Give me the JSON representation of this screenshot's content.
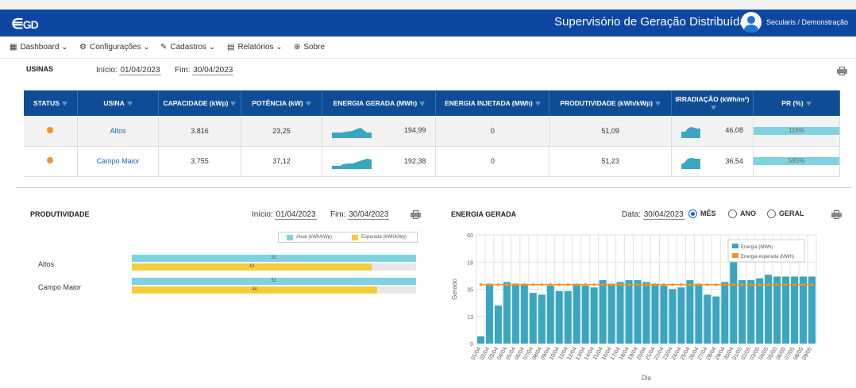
{
  "header": {
    "logo": "GD",
    "title": "Supervisório de Geração Distribuída",
    "user": "Secularis / Demonstração"
  },
  "nav": [
    {
      "icon": "dashboard-icon",
      "label": "Dashboard"
    },
    {
      "icon": "gear-icon",
      "label": "Configurações"
    },
    {
      "icon": "pencil-icon",
      "label": "Cadastros"
    },
    {
      "icon": "report-icon",
      "label": "Relatórios"
    },
    {
      "icon": "globe-icon",
      "label": "Sobre"
    }
  ],
  "usinas": {
    "title": "USINAS",
    "inicio_label": "Início:",
    "inicio": "01/04/2023",
    "fim_label": "Fim:",
    "fim": "30/04/2023",
    "columns": [
      "STATUS",
      "USINA",
      "CAPACIDADE (kWp)",
      "POTÊNCIA (kW)",
      "ENERGIA GERADA (MWh)",
      "ENERGIA INJETADA (MWh)",
      "PRODUTIVIDADE (kWh/kWp)",
      "IRRADIAÇÃO (kWh/m²)",
      "PR (%)"
    ],
    "rows": [
      {
        "usina": "Altos",
        "capacidade": "3.816",
        "potencia": "23,25",
        "energia": "194,99",
        "injetada": "0",
        "produtividade": "51,09",
        "irradiacao": "46,08",
        "pr": "116%",
        "status_color": "#f0952b"
      },
      {
        "usina": "Campo Maior",
        "capacidade": "3.755",
        "potencia": "37,12",
        "energia": "192,38",
        "injetada": "0",
        "produtividade": "51,23",
        "irradiacao": "36,54",
        "pr": "585%",
        "status_color": "#f0952b"
      }
    ]
  },
  "produtividade": {
    "title": "PRODUTIVIDADE",
    "inicio_label": "Início:",
    "inicio": "01/04/2023",
    "fim_label": "Fim:",
    "fim": "30/04/2023",
    "legend": [
      "Atual (kWh/kWp)",
      "Esperada (kWh/kWp)"
    ],
    "colors": [
      "#7fd3e0",
      "#f5cd3b"
    ],
    "max": 51,
    "rows": [
      {
        "label": "Altos",
        "atual": 51,
        "esperada": 43
      },
      {
        "label": "Campo Maior",
        "atual": 51,
        "esperada": 44
      }
    ]
  },
  "energia": {
    "title": "ENERGIA GERADA",
    "data_label": "Data:",
    "data": "30/04/2023",
    "options": [
      "MÊS",
      "ANO",
      "GERAL"
    ],
    "selected": "MÊS"
  },
  "chart_data": {
    "type": "bar",
    "ylabel": "Gerado",
    "xlabel": "Dia",
    "ylim": [
      0,
      60
    ],
    "yticks": [
      "0",
      "13",
      "35",
      "18",
      "60"
    ],
    "categories": [
      "01/04",
      "02/04",
      "03/04",
      "04/04",
      "05/04",
      "06/04",
      "07/04",
      "08/04",
      "09/04",
      "10/04",
      "11/04",
      "12/04",
      "13/04",
      "14/04",
      "15/04",
      "16/04",
      "17/04",
      "18/04",
      "19/04",
      "20/04",
      "21/04",
      "22/04",
      "23/04",
      "24/04",
      "25/04",
      "26/04",
      "27/04",
      "28/04",
      "29/04",
      "30/04",
      "01/05",
      "02/05",
      "03/05",
      "04/05",
      "05/05",
      "06/05",
      "07/05",
      "08/05",
      "09/05"
    ],
    "series": [
      {
        "name": "Energia (MWh)",
        "type": "bar",
        "color": "#3aa6bf",
        "values": [
          4,
          33,
          21,
          34,
          33,
          33,
          28,
          27,
          32,
          29,
          29,
          33,
          32,
          31,
          35,
          33,
          34,
          35,
          35,
          34,
          33,
          32,
          30,
          31,
          35,
          33,
          27,
          26,
          34,
          53,
          35,
          35,
          36,
          38,
          37,
          37,
          37,
          37,
          37
        ]
      },
      {
        "name": "Energia esperada (MWh)",
        "type": "line",
        "color": "#f0952b",
        "values": [
          32.5,
          32.5,
          32.5,
          32.5,
          32.5,
          32.5,
          32.5,
          32.5,
          32.5,
          32.5,
          32.5,
          32.5,
          32.5,
          32.5,
          32.5,
          32.5,
          32.5,
          32.5,
          32.5,
          32.5,
          32.5,
          32.5,
          32.5,
          32.5,
          32.5,
          32.5,
          32.5,
          32.5,
          32.5,
          32.5,
          32.5,
          32.5,
          32.5,
          32.5,
          32.5,
          32.5,
          32.5,
          32.5,
          32.5
        ]
      }
    ],
    "legend_position": "top-right",
    "grid": true
  }
}
